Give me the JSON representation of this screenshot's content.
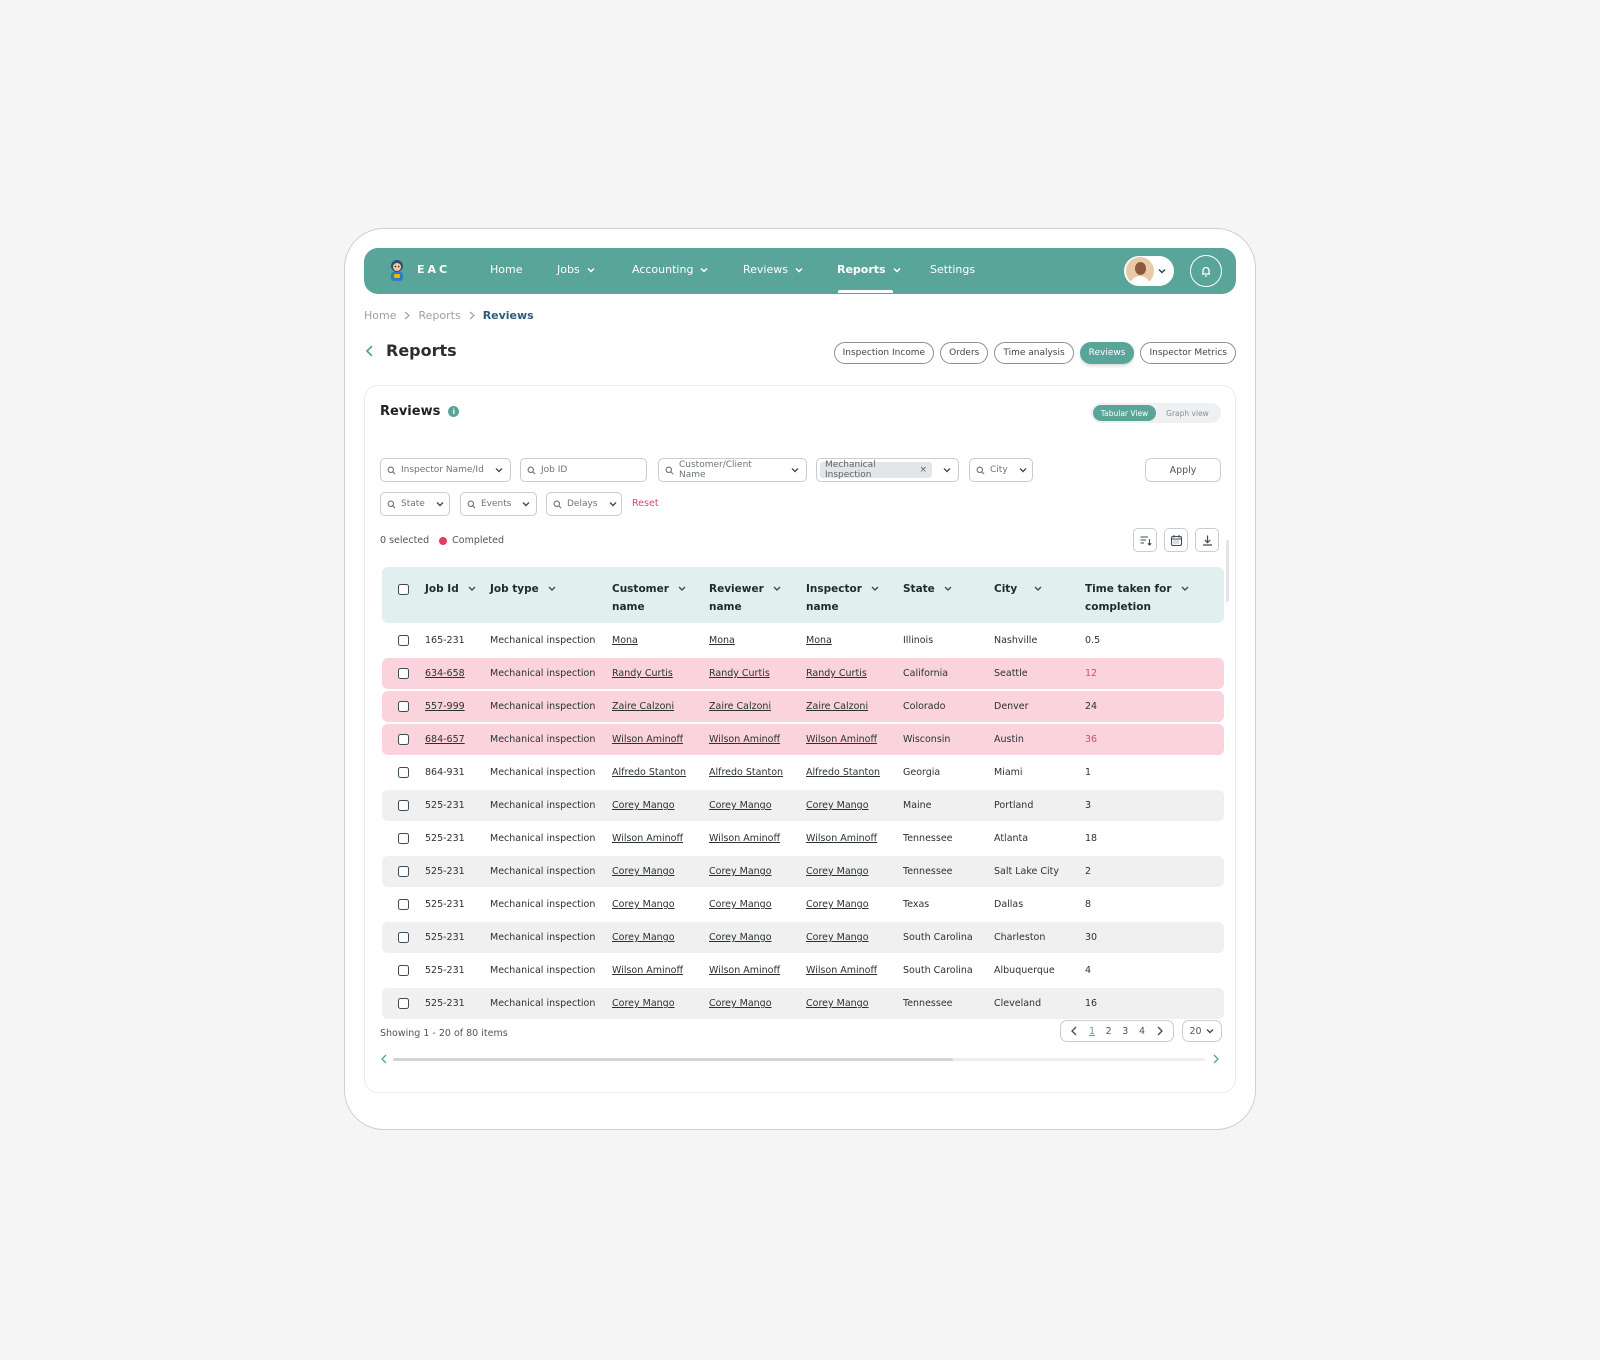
{
  "nav": {
    "brand": "EAC",
    "items": [
      {
        "label": "Home"
      },
      {
        "label": "Jobs"
      },
      {
        "label": "Accounting"
      },
      {
        "label": "Reviews"
      },
      {
        "label": "Reports"
      },
      {
        "label": "Settings"
      }
    ],
    "active": "Reports"
  },
  "breadcrumb": [
    "Home",
    "Reports",
    "Reviews"
  ],
  "page_title": "Reports",
  "report_tabs": [
    "Inspection Income",
    "Orders",
    "Time analysis",
    "Reviews",
    "Inspector Metrics"
  ],
  "active_report_tab": "Reviews",
  "card": {
    "title": "Reviews",
    "info_icon": "i",
    "views": [
      "Tabular View",
      "Graph view"
    ],
    "active_view": "Tabular View"
  },
  "filters": {
    "inspector_placeholder": "Inspector Name/Id",
    "job_id_placeholder": "Job ID",
    "customer_placeholder": "Customer/Client Name",
    "job_type_chip": "Mechanical Inspection",
    "chip_remove": "×",
    "city_placeholder": "City",
    "state_placeholder": "State",
    "events_placeholder": "Events",
    "delays_placeholder": "Delays",
    "apply": "Apply",
    "reset": "Reset"
  },
  "selection": {
    "selected_text": "0 selected",
    "legend_label": "Completed",
    "legend_color": "#e23c5e"
  },
  "table": {
    "columns": [
      [
        "Job Id"
      ],
      [
        "Job type"
      ],
      [
        "Customer",
        "name"
      ],
      [
        "Reviewer",
        "name"
      ],
      [
        "Inspector",
        "name"
      ],
      [
        "State"
      ],
      [
        "City"
      ],
      [
        "Time taken for",
        "completion"
      ]
    ],
    "rows": [
      {
        "job_id": "165-231",
        "job_type": "Mechanical inspection",
        "customer": "Mona",
        "reviewer": "Mona",
        "inspector": "Mona",
        "state": "Illinois",
        "city": "Nashville",
        "time": "0.5",
        "style": "",
        "time_red": false,
        "id_link": false
      },
      {
        "job_id": "634-658",
        "job_type": "Mechanical inspection",
        "customer": "Randy Curtis",
        "reviewer": "Randy Curtis",
        "inspector": "Randy Curtis",
        "state": "California",
        "city": "Seattle",
        "time": "12",
        "style": "flag",
        "time_red": true,
        "id_link": true
      },
      {
        "job_id": "557-999",
        "job_type": "Mechanical inspection",
        "customer": "Zaire Calzoni",
        "reviewer": "Zaire Calzoni",
        "inspector": "Zaire Calzoni",
        "state": "Colorado",
        "city": "Denver",
        "time": "24",
        "style": "flag",
        "time_red": false,
        "id_link": true
      },
      {
        "job_id": "684-657",
        "job_type": "Mechanical inspection",
        "customer": "Wilson Aminoff",
        "reviewer": "Wilson Aminoff",
        "inspector": "Wilson Aminoff",
        "state": "Wisconsin",
        "city": "Austin",
        "time": "36",
        "style": "flag",
        "time_red": true,
        "id_link": true
      },
      {
        "job_id": "864-931",
        "job_type": "Mechanical inspection",
        "customer": "Alfredo Stanton",
        "reviewer": "Alfredo Stanton",
        "inspector": "Alfredo Stanton",
        "state": "Georgia",
        "city": "Miami",
        "time": "1",
        "style": "",
        "time_red": false,
        "id_link": false
      },
      {
        "job_id": "525-231",
        "job_type": "Mechanical inspection",
        "customer": "Corey Mango",
        "reviewer": "Corey Mango",
        "inspector": "Corey Mango",
        "state": "Maine",
        "city": "Portland",
        "time": "3",
        "style": "alt",
        "time_red": false,
        "id_link": false
      },
      {
        "job_id": "525-231",
        "job_type": "Mechanical inspection",
        "customer": "Wilson Aminoff",
        "reviewer": "Wilson Aminoff",
        "inspector": "Wilson Aminoff",
        "state": "Tennessee",
        "city": "Atlanta",
        "time": "18",
        "style": "",
        "time_red": false,
        "id_link": false
      },
      {
        "job_id": "525-231",
        "job_type": "Mechanical inspection",
        "customer": "Corey Mango",
        "reviewer": "Corey Mango",
        "inspector": "Corey Mango",
        "state": "Tennessee",
        "city": "Salt Lake City",
        "time": "2",
        "style": "alt",
        "time_red": false,
        "id_link": false
      },
      {
        "job_id": "525-231",
        "job_type": "Mechanical inspection",
        "customer": "Corey Mango",
        "reviewer": "Corey Mango",
        "inspector": "Corey Mango",
        "state": "Texas",
        "city": "Dallas",
        "time": "8",
        "style": "",
        "time_red": false,
        "id_link": false
      },
      {
        "job_id": "525-231",
        "job_type": "Mechanical inspection",
        "customer": "Corey Mango",
        "reviewer": "Corey Mango",
        "inspector": "Corey Mango",
        "state": "South Carolina",
        "city": "Charleston",
        "time": "30",
        "style": "alt",
        "time_red": false,
        "id_link": false
      },
      {
        "job_id": "525-231",
        "job_type": "Mechanical inspection",
        "customer": "Wilson Aminoff",
        "reviewer": "Wilson Aminoff",
        "inspector": "Wilson Aminoff",
        "state": "South Carolina",
        "city": "Albuquerque",
        "time": "4",
        "style": "",
        "time_red": false,
        "id_link": false
      },
      {
        "job_id": "525-231",
        "job_type": "Mechanical inspection",
        "customer": "Corey Mango",
        "reviewer": "Corey Mango",
        "inspector": "Corey Mango",
        "state": "Tennessee",
        "city": "Cleveland",
        "time": "16",
        "style": "alt",
        "time_red": false,
        "id_link": false
      }
    ]
  },
  "footer": {
    "showing": "Showing 1 - 20 of 80 items",
    "pages": [
      "1",
      "2",
      "3",
      "4"
    ],
    "current_page": "1",
    "per_page": "20"
  },
  "colors": {
    "brand": "#5aa59a",
    "header_bg": "#e1f0ee",
    "flag_row": "#fad3dd",
    "alert": "#d94a6d"
  },
  "icons": [
    "mascot-logo-icon",
    "chevron-down-icon",
    "bell-icon",
    "chevron-left-icon",
    "chevron-right-icon",
    "search-icon",
    "info-icon",
    "sort-icon",
    "calendar-icon",
    "download-icon"
  ]
}
